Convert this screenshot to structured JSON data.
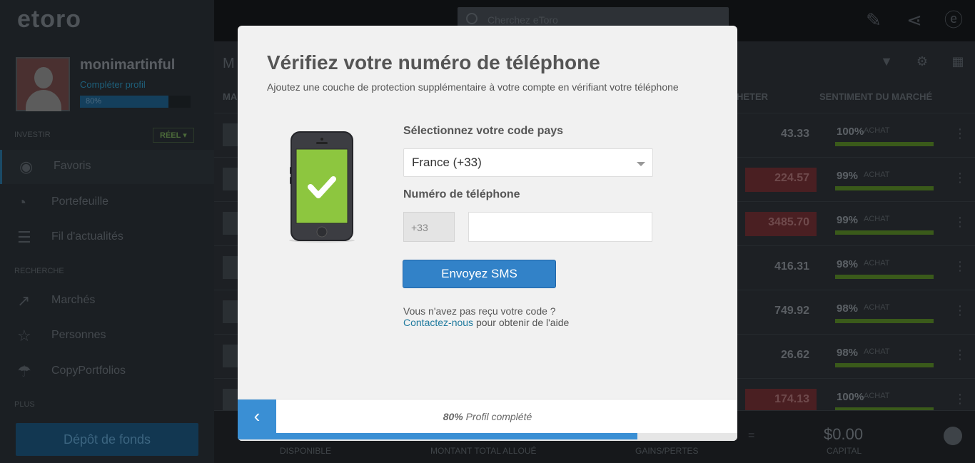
{
  "app": {
    "logo": "etoro",
    "username": "monimartinful",
    "complete_profile": "Compléter profil",
    "profile_percent": "80%",
    "section_invest": "INVESTIR",
    "account_mode": "RÉEL",
    "section_research": "RECHERCHE",
    "section_more": "PLUS",
    "nav": [
      {
        "label": "Favoris",
        "icon": "eye-icon"
      },
      {
        "label": "Portefeuille",
        "icon": "pie-chart-icon"
      },
      {
        "label": "Fil d'actualités",
        "icon": "news-icon"
      },
      {
        "label": "Marchés",
        "icon": "trend-icon"
      },
      {
        "label": "Personnes",
        "icon": "star-icon"
      },
      {
        "label": "CopyPortfolios",
        "icon": "umbrella-icon"
      }
    ],
    "deposit_button": "Dépôt de fonds",
    "search_placeholder": "Cherchez eToro",
    "content_title": "M",
    "col_market": "MA",
    "col_buy": "HETER",
    "col_sentiment": "SENTIMENT DU MARCHÉ",
    "rows": [
      {
        "price": "43.33",
        "pct": "100%",
        "label": "ACHAT",
        "down": false
      },
      {
        "price": "224.57",
        "pct": "99%",
        "label": "ACHAT",
        "down": true
      },
      {
        "price": "3485.70",
        "pct": "99%",
        "label": "ACHAT",
        "down": true
      },
      {
        "price": "416.31",
        "pct": "98%",
        "label": "ACHAT",
        "down": false
      },
      {
        "price": "749.92",
        "pct": "98%",
        "label": "ACHAT",
        "down": false
      },
      {
        "price": "26.62",
        "pct": "98%",
        "label": "ACHAT",
        "down": false
      },
      {
        "price": "174.13",
        "pct": "100%",
        "label": "ACHAT",
        "down": true
      }
    ],
    "bottom": {
      "available": "DISPONIBLE",
      "allocated": "MONTANT TOTAL ALLOUÉ",
      "pnl": "GAINS/PERTES",
      "capital_value": "$0.00",
      "capital": "CAPITAL"
    }
  },
  "modal": {
    "title": "Vérifiez votre numéro de téléphone",
    "subtitle": "Ajoutez une couche de protection supplémentaire à votre compte en vérifiant votre téléphone",
    "country_label": "Sélectionnez votre code pays",
    "country_value": "France (+33)",
    "phone_label": "Numéro de téléphone",
    "prefix": "+33",
    "phone_value": "",
    "send_button": "Envoyez SMS",
    "help_text": "Vous n'avez pas reçu votre code ?",
    "contact_link": "Contactez-nous",
    "help_suffix": "pour obtenir de l'aide",
    "progress_percent": "80%",
    "progress_label": "Profil complété",
    "progress_value": 0.8
  },
  "colors": {
    "accent": "#3282c8",
    "phone_screen": "#8dc63f",
    "link": "#1f7a9e"
  }
}
